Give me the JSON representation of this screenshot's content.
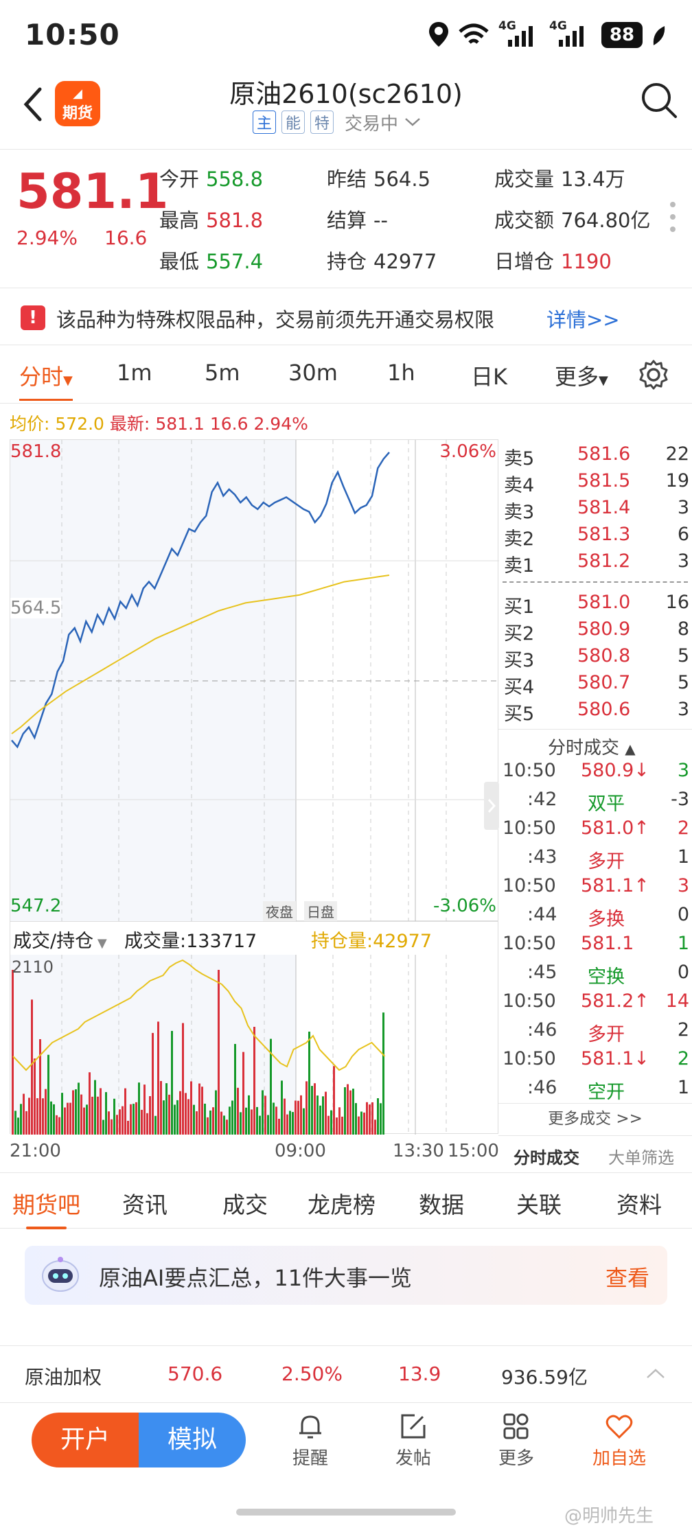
{
  "status_bar": {
    "time": "10:50",
    "battery": "88",
    "network1": "4G",
    "network2": "4G"
  },
  "header": {
    "logo_line1": "期",
    "logo_text": "期货",
    "title": "原油2610(sc2610)",
    "tags": [
      "主",
      "能",
      "特"
    ],
    "trading_status": "交易中"
  },
  "quote": {
    "price": "581.1",
    "change_pct": "2.94%",
    "change": "16.6",
    "fields": [
      {
        "label": "今开",
        "value": "558.8",
        "color": "#15992a"
      },
      {
        "label": "昨结",
        "value": "564.5",
        "color": "#333333"
      },
      {
        "label": "成交量",
        "value": "13.4万",
        "color": "#333333"
      },
      {
        "label": "最高",
        "value": "581.8",
        "color": "#d9303a"
      },
      {
        "label": "结算",
        "value": "--",
        "color": "#333333"
      },
      {
        "label": "成交额",
        "value": "764.80亿",
        "color": "#333333"
      },
      {
        "label": "最低",
        "value": "557.4",
        "color": "#15992a"
      },
      {
        "label": "持仓",
        "value": "42977",
        "color": "#333333"
      },
      {
        "label": "日增仓",
        "value": "1190",
        "color": "#d9303a"
      }
    ]
  },
  "notice": {
    "icon": "!",
    "text": "该品种为特殊权限品种，交易前须先开通交易权限",
    "link": "详情>>"
  },
  "period_tabs": [
    "分时",
    "1m",
    "5m",
    "30m",
    "1h",
    "日K",
    "更多"
  ],
  "avg_info": {
    "avg_label": "均价:",
    "avg_value": "572.0",
    "latest_label": "最新:",
    "latest_value": "581.1 16.6 2.94%"
  },
  "chart_data": {
    "type": "line",
    "title": "",
    "price_axis": {
      "max": "581.8",
      "mid": "564.5",
      "min": "547.2"
    },
    "pct_axis": {
      "max": "3.06%",
      "min": "-3.06%"
    },
    "session_labels": [
      "夜盘",
      "日盘"
    ],
    "x_ticks": [
      "21:00",
      "09:00",
      "13:30",
      "15:00"
    ],
    "ylim": [
      547.2,
      581.8
    ],
    "series": [
      {
        "name": "价格",
        "color": "#2a64b8",
        "values": [
          560,
          559.5,
          560.5,
          561,
          560.2,
          561.5,
          562.8,
          563.5,
          565.2,
          566,
          568,
          568.5,
          567.5,
          569,
          568.2,
          569.5,
          568.8,
          570,
          569.2,
          570.5,
          570,
          571,
          570.2,
          571.5,
          572,
          571.5,
          572.5,
          573.5,
          574.5,
          574,
          575,
          576,
          575.8,
          576.5,
          577,
          578.8,
          579.5,
          578.5,
          579,
          578.6,
          578,
          578.4,
          577.8,
          577.5,
          578,
          577.7,
          578,
          578.2,
          578.4,
          578.1,
          577.8,
          577.5,
          577.3,
          576.5,
          577,
          577.9,
          579.5,
          580.3,
          579.2,
          578.2,
          577.2,
          577.6,
          577.8,
          578.5,
          580.6,
          581.3,
          581.8
        ]
      },
      {
        "name": "均价",
        "color": "#e7c21c",
        "values": [
          560.5,
          561,
          561.6,
          562.2,
          562.7,
          563.2,
          563.7,
          564.1,
          564.5,
          564.9,
          565.3,
          565.7,
          566.1,
          566.5,
          566.9,
          567.3,
          567.7,
          568,
          568.3,
          568.6,
          568.9,
          569.2,
          569.5,
          569.8,
          570,
          570.2,
          570.4,
          570.5,
          570.6,
          570.7,
          570.8,
          570.9,
          571,
          571.2,
          571.4,
          571.6,
          571.8,
          572,
          572.1,
          572.2,
          572.3,
          572.4,
          572.5
        ]
      }
    ],
    "volume_panel": {
      "selector": "成交/持仓",
      "volume_label": "成交量:",
      "volume_value": "133717",
      "oi_label": "持仓量:",
      "oi_value": "42977",
      "max_tick": "2110"
    }
  },
  "order_book": {
    "asks": [
      {
        "label": "卖5",
        "price": "581.6",
        "qty": "22"
      },
      {
        "label": "卖4",
        "price": "581.5",
        "qty": "19"
      },
      {
        "label": "卖3",
        "price": "581.4",
        "qty": "3"
      },
      {
        "label": "卖2",
        "price": "581.3",
        "qty": "6"
      },
      {
        "label": "卖1",
        "price": "581.2",
        "qty": "3"
      }
    ],
    "bids": [
      {
        "label": "买1",
        "price": "581.0",
        "qty": "16"
      },
      {
        "label": "买2",
        "price": "580.9",
        "qty": "8"
      },
      {
        "label": "买3",
        "price": "580.8",
        "qty": "5"
      },
      {
        "label": "买4",
        "price": "580.7",
        "qty": "5"
      },
      {
        "label": "买5",
        "price": "580.6",
        "qty": "3"
      }
    ]
  },
  "ticks": {
    "title": "分时成交",
    "rows": [
      {
        "t": "10:50",
        "p": "580.9↓",
        "pc": "#d9303a",
        "q": "3",
        "qc": "#15992a"
      },
      {
        "t": ":42",
        "p": "双平",
        "pc": "#15992a",
        "q": "-3",
        "qc": "#333333"
      },
      {
        "t": "10:50",
        "p": "581.0↑",
        "pc": "#d9303a",
        "q": "2",
        "qc": "#d9303a"
      },
      {
        "t": ":43",
        "p": "多开",
        "pc": "#d9303a",
        "q": "1",
        "qc": "#333333"
      },
      {
        "t": "10:50",
        "p": "581.1↑",
        "pc": "#d9303a",
        "q": "3",
        "qc": "#d9303a"
      },
      {
        "t": ":44",
        "p": "多换",
        "pc": "#d9303a",
        "q": "0",
        "qc": "#333333"
      },
      {
        "t": "10:50",
        "p": "581.1",
        "pc": "#d9303a",
        "q": "1",
        "qc": "#15992a"
      },
      {
        "t": ":45",
        "p": "空换",
        "pc": "#15992a",
        "q": "0",
        "qc": "#333333"
      },
      {
        "t": "10:50",
        "p": "581.2↑",
        "pc": "#d9303a",
        "q": "14",
        "qc": "#d9303a"
      },
      {
        "t": ":46",
        "p": "多开",
        "pc": "#d9303a",
        "q": "2",
        "qc": "#333333"
      },
      {
        "t": "10:50",
        "p": "581.1↓",
        "pc": "#d9303a",
        "q": "2",
        "qc": "#15992a"
      },
      {
        "t": ":46",
        "p": "空开",
        "pc": "#15992a",
        "q": "1",
        "qc": "#333333"
      }
    ],
    "more": "更多成交 >>",
    "subtab_active": "分时成交",
    "subtab_other": "大单筛选"
  },
  "content_tabs": [
    "期货吧",
    "资讯",
    "成交",
    "龙虎榜",
    "数据",
    "关联",
    "资料"
  ],
  "ai_banner": {
    "text": "原油AI要点汇总，11件大事一览",
    "button": "查看"
  },
  "ticker": {
    "name": "原油加权",
    "price": "570.6",
    "pct": "2.50%",
    "change": "13.9",
    "amount": "936.59亿"
  },
  "bottom_nav": {
    "open": "开户",
    "simulate": "模拟",
    "items": [
      {
        "label": "提醒",
        "icon": "bell-icon"
      },
      {
        "label": "发帖",
        "icon": "compose-icon"
      },
      {
        "label": "更多",
        "icon": "grid-icon"
      },
      {
        "label": "加自选",
        "icon": "heart-icon"
      }
    ]
  },
  "watermark": "@明帅先生",
  "colors": {
    "up": "#d9303a",
    "down": "#15992a",
    "accent": "#ee5a1a",
    "link": "#2b6fd6"
  }
}
